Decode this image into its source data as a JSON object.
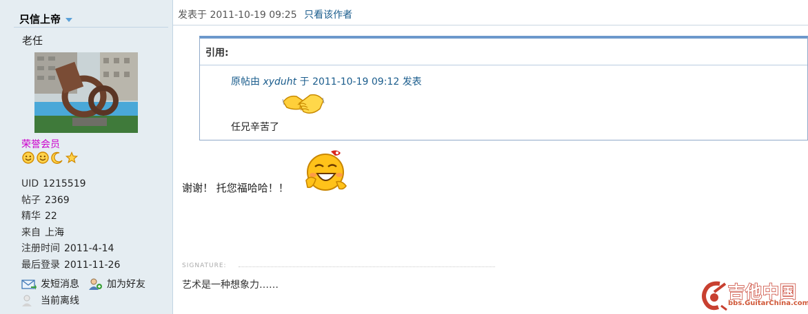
{
  "profile": {
    "username": "只信上帝",
    "nickname": "老任",
    "group": "荣誉会员",
    "stats": [
      {
        "key": "UID",
        "value": "1215519"
      },
      {
        "key": "帖子",
        "value": "2369"
      },
      {
        "key": "精华",
        "value": "22"
      },
      {
        "key": "来自",
        "value": "上海"
      },
      {
        "key": "注册时间",
        "value": "2011-4-14"
      },
      {
        "key": "最后登录",
        "value": "2011-11-26"
      }
    ],
    "actions": {
      "send_message": "发短消息",
      "add_friend": "加为好友",
      "status": "当前离线"
    },
    "rank_icons": [
      "smiley-icon",
      "smiley-icon",
      "moon-icon",
      "star-icon"
    ]
  },
  "post": {
    "posted_label": "发表于",
    "posted_time": "2011-10-19 09:25",
    "only_author": "只看该作者",
    "quote": {
      "title": "引用:",
      "meta_prefix": "原帖由",
      "author": "xyduht",
      "meta_mid": "于",
      "time": "2011-10-19 09:12",
      "meta_suffix": "发表",
      "text": "任兄辛苦了"
    },
    "reply": "谢谢！ 托您福哈哈！！",
    "signature_label": "SIGNATURE:",
    "signature": "艺术是一种想象力……"
  },
  "watermark": {
    "title": "吉他中国",
    "url": "bbs.GuitarChina.com"
  },
  "colors": {
    "sidebar_bg": "#e5edf2",
    "link": "#1a5c8c",
    "group": "#cc00cc",
    "quote_border": "#6c98cc"
  }
}
